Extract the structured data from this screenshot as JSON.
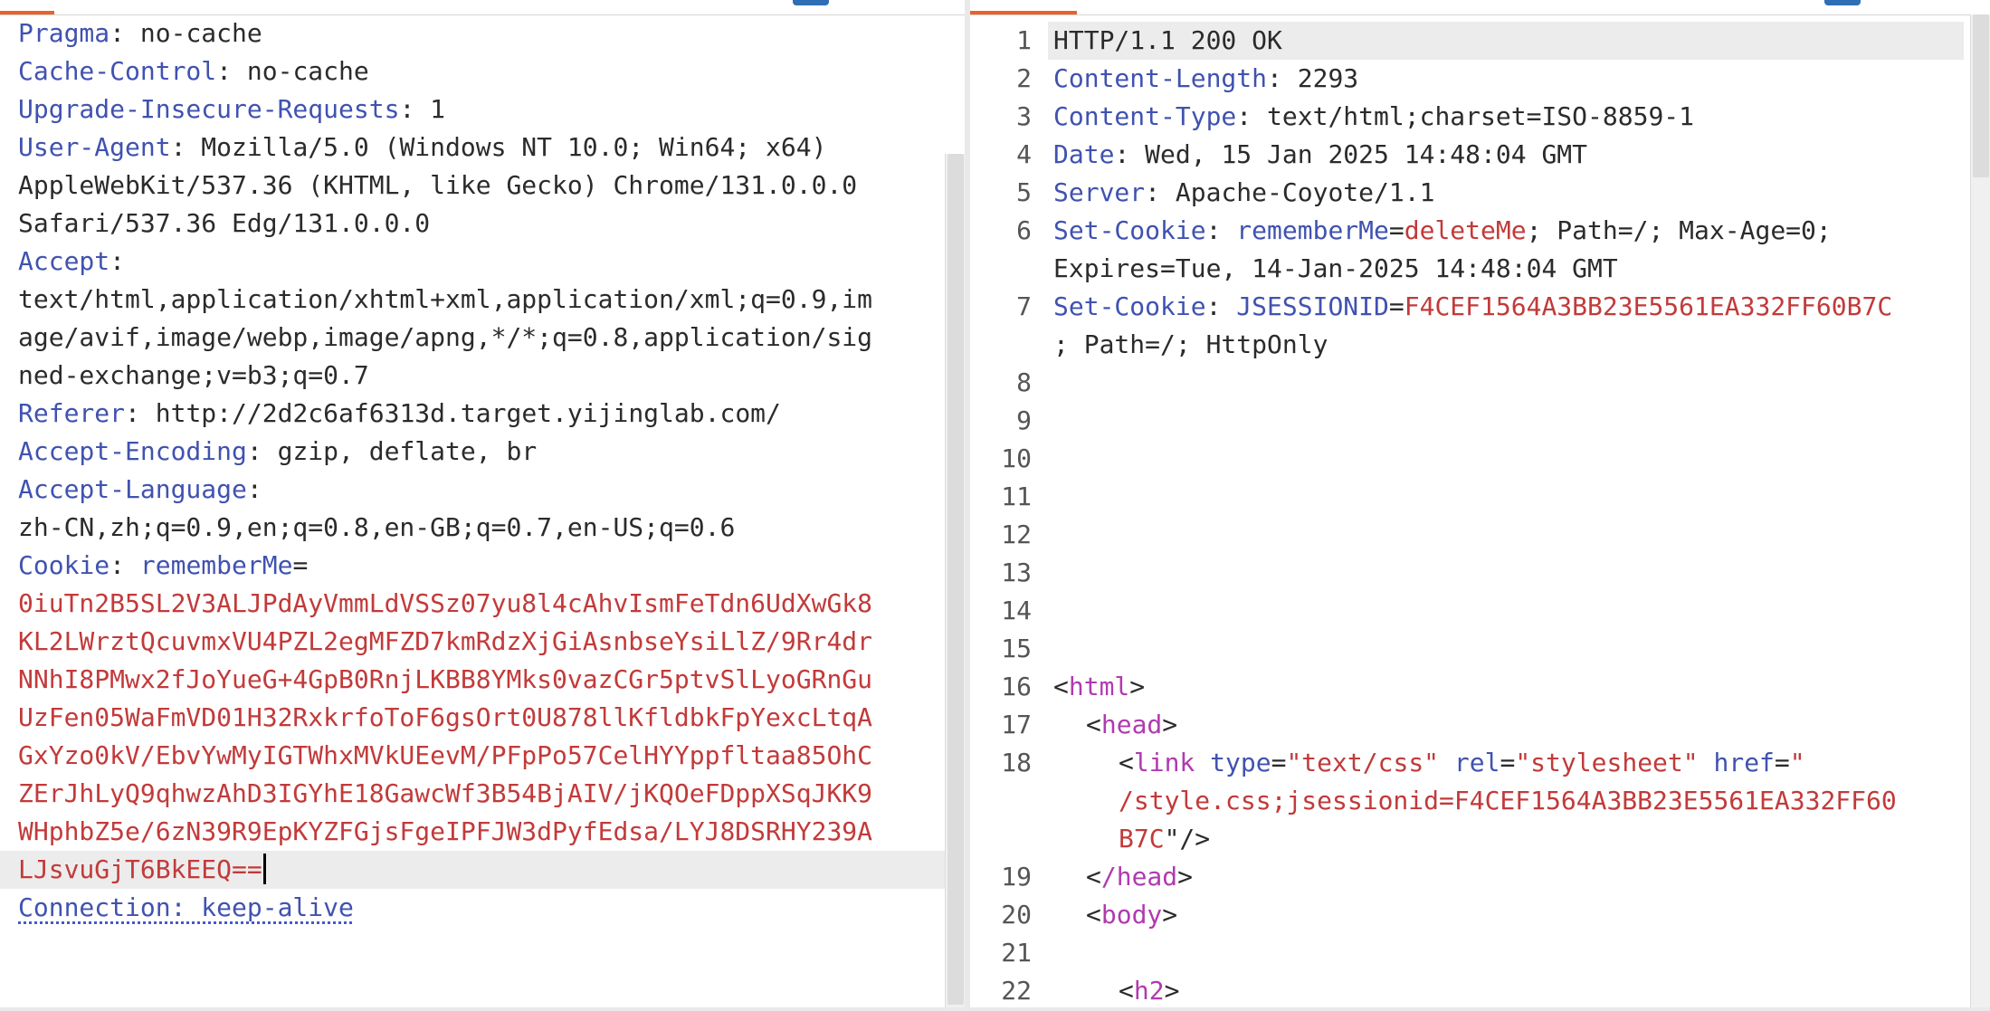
{
  "request": {
    "lines": [
      {
        "key": "Pragma",
        "value": "no-cache"
      },
      {
        "key": "Cache-Control",
        "value": "no-cache"
      },
      {
        "key": "Upgrade-Insecure-Requests",
        "value": "1"
      },
      {
        "key": "User-Agent",
        "value": "Mozilla/5.0 (Windows NT 10.0; Win64; x64)"
      },
      {
        "cont": "AppleWebKit/537.36 (KHTML, like Gecko) Chrome/131.0.0.0"
      },
      {
        "cont": "Safari/537.36 Edg/131.0.0.0"
      },
      {
        "key": "Accept",
        "value": ""
      },
      {
        "cont": "text/html,application/xhtml+xml,application/xml;q=0.9,im"
      },
      {
        "cont": "age/avif,image/webp,image/apng,*/*;q=0.8,application/sig"
      },
      {
        "cont": "ned-exchange;v=b3;q=0.7"
      },
      {
        "key": "Referer",
        "value": "http://2d2c6af6313d.target.yijinglab.com/"
      },
      {
        "key": "Accept-Encoding",
        "value": "gzip, deflate, br"
      },
      {
        "key": "Accept-Language",
        "value": ""
      },
      {
        "cont": "zh-CN,zh;q=0.9,en;q=0.8,en-GB;q=0.7,en-US;q=0.6"
      }
    ],
    "cookie_key": "Cookie",
    "cookie_name": "rememberMe",
    "cookie_value_lines": [
      "0iuTn2B5SL2V3ALJPdAyVmmLdVSSz07yu8l4cAhvIsmFeTdn6UdXwGk8",
      "KL2LWrztQcuvmxVU4PZL2egMFZD7kmRdzXjGiAsnbseYsiLlZ/9Rr4dr",
      "NNhI8PMwx2fJoYueG+4GpB0RnjLKBB8YMks0vazCGr5ptvSlLyoGRnGu",
      "UzFen05WaFmVD01H32RxkrfoToF6gsOrt0U878llKfldbkFpYexcLtqA",
      "GxYzo0kV/EbvYwMyIGTWhxMVkUEevM/PFpPo57CelHYYppfltaa85OhC",
      "ZErJhLyQ9qhwzAhD3IGYhE18GawcWf3B54BjAIV/jKQOeFDppXSqJKK9",
      "WHphbZ5e/6zN39R9EpKYZFGjsFgeIPFJW3dPyfEdsa/LYJ8DSRHY239A",
      "LJsvuGjT6BkEEQ=="
    ],
    "connection_line": "Connection: keep-alive"
  },
  "response": {
    "line_numbers": [
      "1",
      "2",
      "3",
      "4",
      "5",
      "6",
      "",
      "7",
      "",
      "8",
      "9",
      "10",
      "11",
      "12",
      "13",
      "14",
      "15",
      "16",
      "17",
      "18",
      "",
      "",
      "19",
      "20",
      "21",
      "22"
    ],
    "status_line": "HTTP/1.1 200 OK",
    "headers": [
      {
        "key": "Content-Length",
        "value": "2293"
      },
      {
        "key": "Content-Type",
        "value": "text/html;charset=ISO-8859-1"
      },
      {
        "key": "Date",
        "value": "Wed, 15 Jan 2025 14:48:04 GMT"
      },
      {
        "key": "Server",
        "value": "Apache-Coyote/1.1"
      }
    ],
    "set_cookie_1": {
      "key": "Set-Cookie",
      "name": "rememberMe",
      "value": "deleteMe",
      "rest": "; Path=/; Max-Age=0;",
      "cont": "Expires=Tue, 14-Jan-2025 14:48:04 GMT"
    },
    "set_cookie_2": {
      "key": "Set-Cookie",
      "name": "JSESSIONID",
      "value": "F4CEF1564A3BB23E5561EA332FF60B7C",
      "cont": "; Path=/; HttpOnly"
    },
    "html": {
      "open_html": "html",
      "open_head": "head",
      "link_tag": "link",
      "link_attr1": "type",
      "link_val1": "\"text/css\"",
      "link_attr2": "rel",
      "link_val2": "\"stylesheet\"",
      "link_attr3": "href",
      "link_val3_start": "\"",
      "link_href_l1": "/style.css;jsessionid=F4CEF1564A3BB23E5561EA332FF60",
      "link_href_l2": "B7C",
      "link_end": "\"/>",
      "close_head": "/head",
      "open_body": "body",
      "h2": "h2"
    }
  },
  "colors": {
    "tab_accent": "#e8632b",
    "header_key": "#4052b0",
    "cookie_value": "#c23a3a",
    "tag": "#b03ab0"
  }
}
